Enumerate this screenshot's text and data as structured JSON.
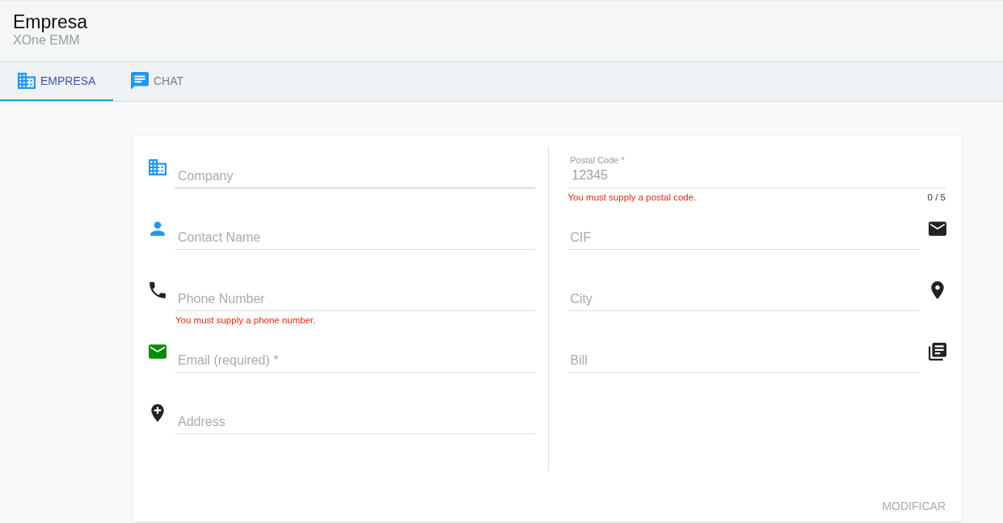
{
  "header": {
    "title": "Empresa",
    "subtitle": "XOne EMM"
  },
  "tabs": [
    {
      "label": "EMPRESA",
      "selected": true
    },
    {
      "label": "CHAT",
      "selected": false
    }
  ],
  "form": {
    "left_fields": [
      {
        "placeholder": "Company",
        "disabled": true
      },
      {
        "placeholder": "Contact Name",
        "disabled": false
      },
      {
        "placeholder": "Phone Number",
        "disabled": false,
        "error": "You must supply a phone number."
      },
      {
        "placeholder": "Email (required) *",
        "disabled": false
      },
      {
        "placeholder": "Address",
        "disabled": false
      }
    ],
    "right_fields": [
      {
        "label": "Postal Code *",
        "value": "12345",
        "disabled": false,
        "error": "You must supply a postal code.",
        "counter": "0 / 5"
      },
      {
        "placeholder": "CIF",
        "disabled": false
      },
      {
        "placeholder": "City",
        "disabled": false
      },
      {
        "placeholder": "Bill",
        "disabled": false
      }
    ],
    "button": {
      "label": "MODIFICAR",
      "disabled": true
    }
  }
}
